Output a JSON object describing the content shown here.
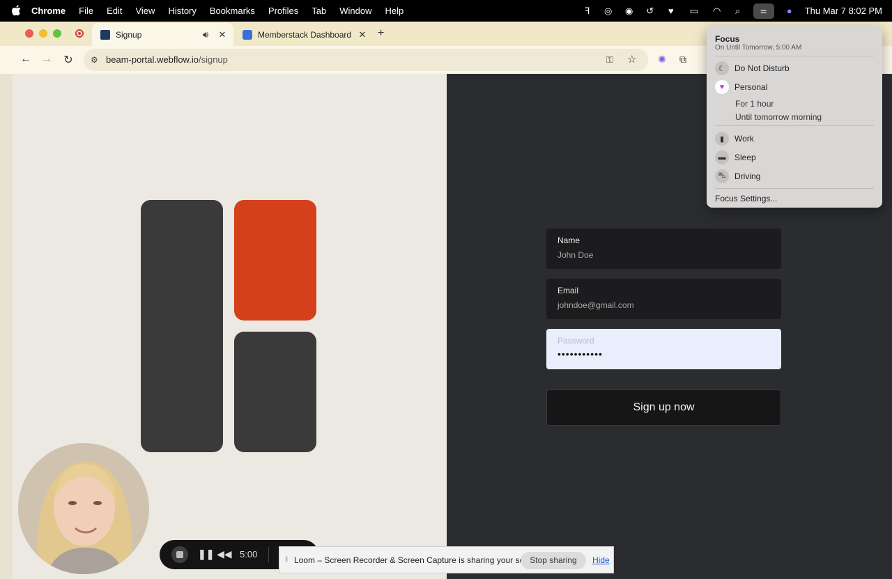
{
  "menubar": {
    "app": "Chrome",
    "menus": [
      "File",
      "Edit",
      "View",
      "History",
      "Bookmarks",
      "Profiles",
      "Tab",
      "Window",
      "Help"
    ],
    "datetime": "Thu Mar 7  8:02 PM"
  },
  "browser": {
    "tabs": [
      {
        "title": "Signup",
        "active": true
      },
      {
        "title": "Memberstack Dashboard",
        "active": false
      }
    ],
    "url_host": "beam-portal.webflow.io",
    "url_path": "/signup"
  },
  "form": {
    "name_label": "Name",
    "name_value": "John Doe",
    "email_label": "Email",
    "email_value": "johndoe@gmail.com",
    "password_label": "Password",
    "password_value": "•••••••••••",
    "submit_label": "Sign up now"
  },
  "colors": {
    "accent_block": "#d4401a",
    "dark_block": "#3a3a3a",
    "page_left_bg": "#ece9e2",
    "page_right_bg": "#2b2c30"
  },
  "focus_menu": {
    "title": "Focus",
    "subtitle": "On Until Tomorrow, 5:00 AM",
    "items": [
      {
        "label": "Do Not Disturb",
        "icon": "moon-icon"
      },
      {
        "label": "Personal",
        "icon": "heart-icon"
      },
      {
        "label": "Work",
        "icon": "badge-icon"
      },
      {
        "label": "Sleep",
        "icon": "bed-icon"
      },
      {
        "label": "Driving",
        "icon": "car-icon"
      }
    ],
    "personal_options": [
      "For 1 hour",
      "Until tomorrow morning"
    ],
    "settings_label": "Focus Settings..."
  },
  "loom": {
    "timer": "5:00",
    "share_message": "Loom – Screen Recorder & Screen Capture is sharing your screen.",
    "stop_sharing": "Stop sharing",
    "hide": "Hide"
  }
}
